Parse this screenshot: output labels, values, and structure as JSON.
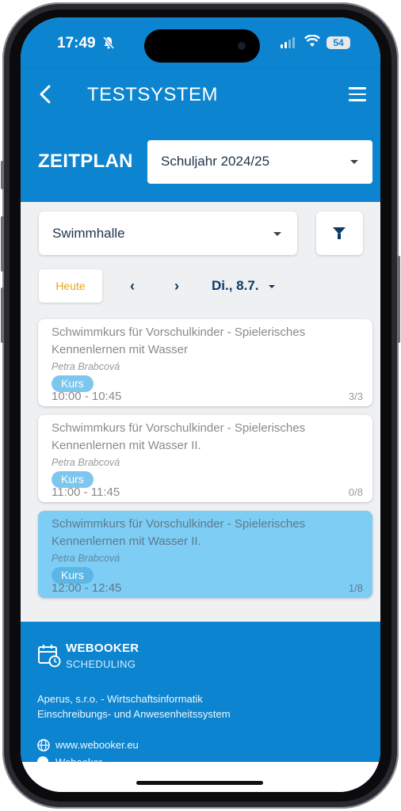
{
  "status": {
    "time": "17:49",
    "battery": "54"
  },
  "appbar": {
    "title": "TESTSYSTEM"
  },
  "schedule": {
    "heading": "ZEITPLAN",
    "school_year": "Schuljahr 2024/25"
  },
  "filters": {
    "room": "Swimmhalle"
  },
  "datenav": {
    "today_label": "Heute",
    "prev": "‹",
    "next": "›",
    "date": "Di., 8.7."
  },
  "events": [
    {
      "title": "Schwimmkurs für Vorschulkinder - Spielerisches Kennenlernen mit Wasser",
      "instructor": "Petra Brabcová",
      "type": "Kurs",
      "time": "10:00 - 10:45",
      "capacity": "3/3"
    },
    {
      "title": "Schwimmkurs für Vorschulkinder - Spielerisches Kennenlernen mit Wasser II.",
      "instructor": "Petra Brabcová",
      "type": "Kurs",
      "time": "11:00 - 11:45",
      "capacity": "0/8"
    },
    {
      "title": "Schwimmkurs für Vorschulkinder - Spielerisches Kennenlernen mit Wasser II.",
      "instructor": "Petra Brabcová",
      "type": "Kurs",
      "time": "12:00 - 12:45",
      "capacity": "1/8"
    }
  ],
  "footer": {
    "brand": "WEBOOKER",
    "brand_sub": "SCHEDULING",
    "company_line1": "Aperus, s.r.o. - Wirtschaftsinformatik",
    "company_line2": "Einschreibungs- und Anwesenheitssystem",
    "website": "www.webooker.eu",
    "social": "Webooker"
  },
  "colors": {
    "primary": "#0c84cf",
    "accent": "#e6a817",
    "active_card": "#7dcdf5",
    "dark_text": "#0a3c68"
  }
}
